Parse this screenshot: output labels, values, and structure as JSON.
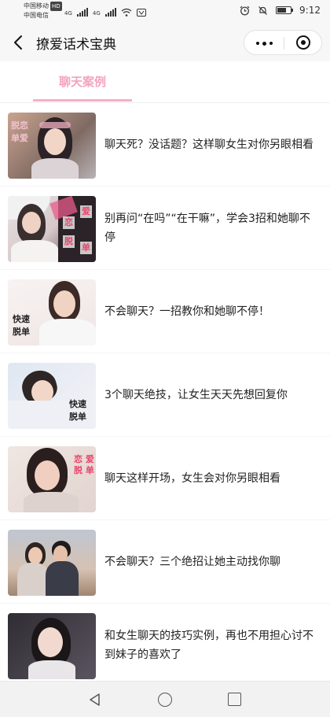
{
  "status_bar": {
    "carrier_1": "中国移动",
    "carrier_1_badge": "HD",
    "carrier_2": "中国电信",
    "network_1": "4G",
    "network_2": "4G",
    "time": "9:12",
    "battery_level": 0.7
  },
  "nav": {
    "title": "撩爱话术宝典"
  },
  "tabs": [
    {
      "label": "聊天案例",
      "active": true
    }
  ],
  "colors": {
    "accent": "#f6b0c5",
    "tab_text": "#f4a3bd",
    "stamp_red": "#e8456b"
  },
  "articles": [
    {
      "title": "聊天死？没话题？这样聊女生对你另眼相看",
      "thumb_text": [
        "脱恋",
        "单爱"
      ]
    },
    {
      "title": "别再问“在吗”“在干嘛”，学会3招和她聊不停",
      "thumb_text": [
        "恋",
        "爱",
        "脱",
        "单"
      ]
    },
    {
      "title": "不会聊天？一招教你和她聊不停！",
      "thumb_text": [
        "快速",
        "脱单"
      ]
    },
    {
      "title": "3个聊天绝技，让女生天天先想回复你",
      "thumb_text": [
        "快速",
        "脱单"
      ]
    },
    {
      "title": "聊天这样开场，女生会对你另眼相看",
      "thumb_text": [
        "恋 爱",
        "脱 单"
      ]
    },
    {
      "title": "不会聊天？三个绝招让她主动找你聊",
      "thumb_text": []
    },
    {
      "title": "和女生聊天的技巧实例，再也不用担心讨不到妹子的喜欢了",
      "thumb_text": []
    }
  ],
  "icons": {
    "back": "chevron-left-icon",
    "more": "more-dots-icon",
    "close": "target-close-icon",
    "sys_back": "triangle-back-icon",
    "sys_home": "circle-home-icon",
    "sys_recent": "square-recent-icon"
  }
}
